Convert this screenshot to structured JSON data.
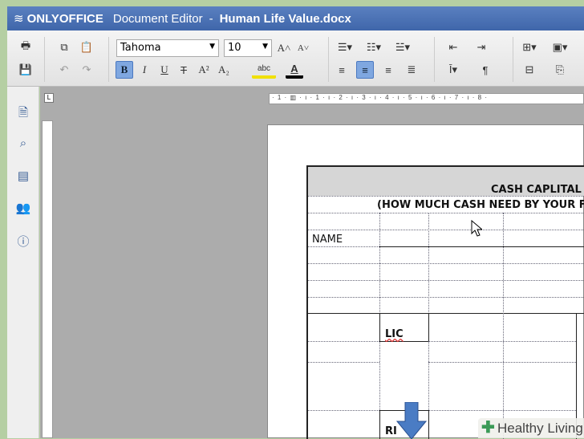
{
  "title": {
    "app": "ONLYOFFICE",
    "module": "Document Editor",
    "separator": "-",
    "document": "Human Life Value.docx"
  },
  "toolbar": {
    "font_name": "Tahoma",
    "font_size": "10",
    "bold": "B",
    "italic": "I",
    "underline": "U",
    "strike": "T",
    "superscript": "A²",
    "subscript": "A₂",
    "highlight": "abc",
    "font_color": "A",
    "grow": "A˄",
    "shrink": "A˅",
    "paragraph": "¶",
    "active_alignment": "center"
  },
  "ruler": {
    "marks": "· 1 · ▥ · ı · 1 · ı · 2 · ı · 3 · ı · 4 · ı · 5 · ı · 6 · ı · 7 · ı · 8 ·",
    "tab": "L"
  },
  "document": {
    "header": "CASH CAPLITAL",
    "subheader": "(HOW MUCH CASH NEED BY YOUR F",
    "name_label": "NAME",
    "lic": "LIC",
    "ri": "RI"
  },
  "watermark": "Healthy Living"
}
